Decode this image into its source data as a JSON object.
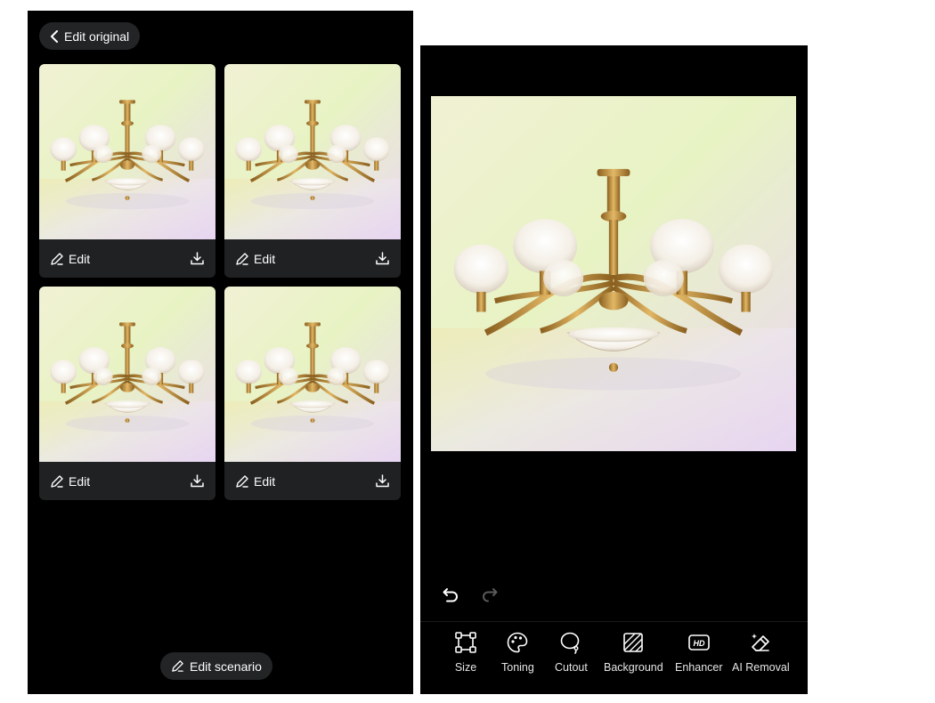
{
  "left": {
    "back_label": "Edit original",
    "cards": [
      {
        "edit_label": "Edit"
      },
      {
        "edit_label": "Edit"
      },
      {
        "edit_label": "Edit"
      },
      {
        "edit_label": "Edit"
      }
    ],
    "scenario_label": "Edit scenario"
  },
  "right": {
    "tools": [
      {
        "label": "Size",
        "icon": "crop-frame-icon"
      },
      {
        "label": "Toning",
        "icon": "palette-icon"
      },
      {
        "label": "Cutout",
        "icon": "lasso-icon"
      },
      {
        "label": "Background",
        "icon": "hatch-square-icon"
      },
      {
        "label": "Enhancer",
        "icon": "hd-icon"
      },
      {
        "label": "AI Removal",
        "icon": "eraser-sparkle-icon"
      }
    ]
  },
  "colors": {
    "panel_bg": "#000000",
    "card_bar_bg": "#1f2123",
    "pill_bg": "#222426",
    "brass": "#b8893a",
    "glass": "#f4efe6"
  }
}
